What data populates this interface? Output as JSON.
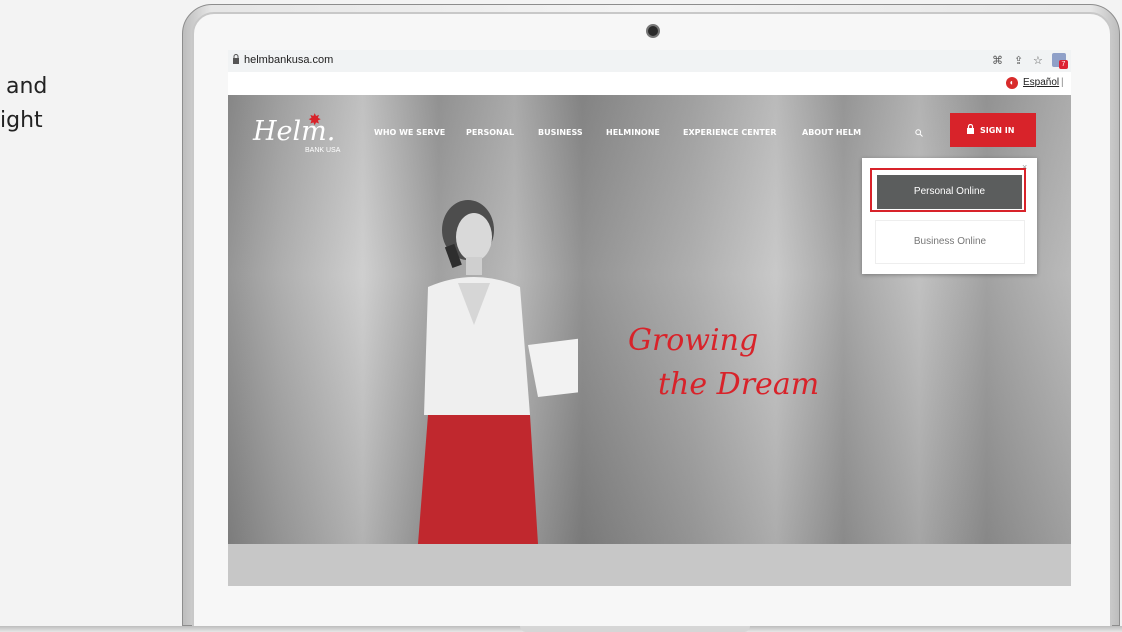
{
  "side_text": {
    "line1": "and",
    "line2": "ight"
  },
  "browser": {
    "url": "helmbankusa.com",
    "toolbar_icons": [
      "translate-icon",
      "share-icon",
      "star-icon",
      "extension-icon"
    ],
    "extension_badge": "7"
  },
  "lang_bar": {
    "spanish_link": "Español",
    "separator": "|"
  },
  "site": {
    "logo_text": "Helm.",
    "logo_sub": "BANK USA",
    "nav": [
      "WHO WE SERVE",
      "PERSONAL",
      "BUSINESS",
      "HELMINONE",
      "EXPERIENCE CENTER",
      "ABOUT HELM"
    ],
    "signin_label": "SIGN IN",
    "dropdown": {
      "close": "×",
      "personal": "Personal Online",
      "business": "Business Online"
    },
    "hero_script_line1": "Growing",
    "hero_script_line2": "the Dream",
    "colors": {
      "accent": "#d8232a",
      "dark_button": "#5b5d5d"
    }
  }
}
